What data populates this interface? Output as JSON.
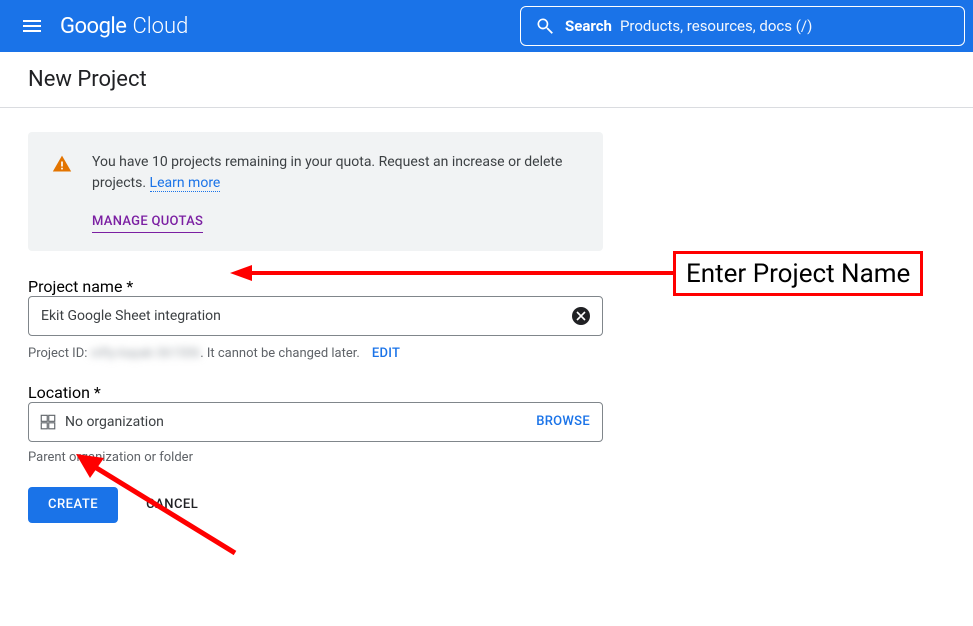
{
  "header": {
    "brand_primary": "Google",
    "brand_secondary": "Cloud",
    "search_label": "Search",
    "search_placeholder": "Products, resources, docs (/)"
  },
  "page": {
    "title": "New Project"
  },
  "notice": {
    "text_a": "You have 10 projects remaining in your quota. Request an increase or delete projects. ",
    "learn_more": "Learn more",
    "manage_quotas": "MANAGE QUOTAS"
  },
  "project_name": {
    "legend": "Project name *",
    "value": "Ekit Google Sheet integration"
  },
  "project_id": {
    "prefix": "Project ID: ",
    "masked": "nifty-kayak-361506",
    "suffix": ". It cannot be changed later.",
    "edit": "EDIT"
  },
  "location": {
    "legend": "Location *",
    "value": "No organization",
    "browse": "BROWSE",
    "helper": "Parent organization or folder"
  },
  "buttons": {
    "create": "CREATE",
    "cancel": "CANCEL"
  },
  "annotation": {
    "callout": "Enter Project Name"
  }
}
